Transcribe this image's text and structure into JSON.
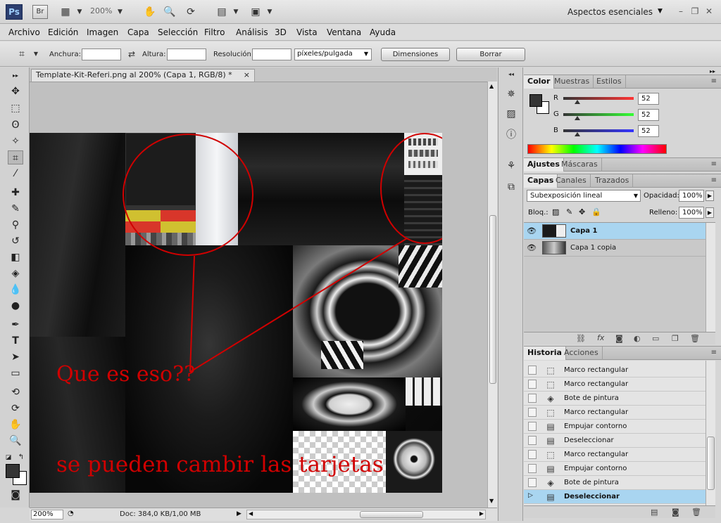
{
  "app": {
    "logo": "Ps",
    "bridge_button": "Br",
    "zoom_level": "200%",
    "workspace": "Aspectos esenciales"
  },
  "menu": [
    "Archivo",
    "Edición",
    "Imagen",
    "Capa",
    "Selección",
    "Filtro",
    "Análisis",
    "3D",
    "Vista",
    "Ventana",
    "Ayuda"
  ],
  "options": {
    "width_label": "Anchura:",
    "height_label": "Altura:",
    "resolution_label": "Resolución:",
    "resolution_unit": "píxeles/pulgada",
    "dimensions_button": "Dimensiones",
    "clear_button": "Borrar"
  },
  "document": {
    "tab_title": "Template-Kit-Referi.png al 200% (Capa 1, RGB/8) *",
    "close": "×",
    "status_zoom": "200%",
    "status_doc": "Doc: 384,0 KB/1,00 MB",
    "annotation_1": "Que es eso??",
    "annotation_2": "se pueden cambir las tarjetas"
  },
  "color_panel": {
    "tabs": [
      "Color",
      "Muestras",
      "Estilos"
    ],
    "channels": [
      {
        "label": "R",
        "value": "52",
        "color": "#d01010"
      },
      {
        "label": "G",
        "value": "52",
        "color": "#10b010"
      },
      {
        "label": "B",
        "value": "52",
        "color": "#2020d0"
      }
    ]
  },
  "adjust_panel": {
    "tabs": [
      "Ajustes",
      "Máscaras"
    ]
  },
  "layers_panel": {
    "tabs": [
      "Capas",
      "Canales",
      "Trazados"
    ],
    "blend_mode": "Subexposición lineal",
    "opacity_label": "Opacidad:",
    "opacity_value": "100%",
    "lock_label": "Bloq.:",
    "fill_label": "Relleno:",
    "fill_value": "100%",
    "layers": [
      {
        "name": "Capa 1",
        "selected": true
      },
      {
        "name": "Capa 1 copia",
        "selected": false
      }
    ]
  },
  "history_panel": {
    "tabs": [
      "Historia",
      "Acciones"
    ],
    "items": [
      {
        "name": "Marco rectangular",
        "icon": "marquee-icon"
      },
      {
        "name": "Marco rectangular",
        "icon": "marquee-icon"
      },
      {
        "name": "Bote de pintura",
        "icon": "paint-bucket-icon"
      },
      {
        "name": "Marco rectangular",
        "icon": "marquee-icon"
      },
      {
        "name": "Empujar contorno",
        "icon": "document-icon"
      },
      {
        "name": "Deseleccionar",
        "icon": "document-icon"
      },
      {
        "name": "Marco rectangular",
        "icon": "marquee-icon"
      },
      {
        "name": "Empujar contorno",
        "icon": "document-icon"
      },
      {
        "name": "Bote de pintura",
        "icon": "paint-bucket-icon"
      },
      {
        "name": "Deseleccionar",
        "icon": "document-icon",
        "selected": true
      }
    ]
  }
}
